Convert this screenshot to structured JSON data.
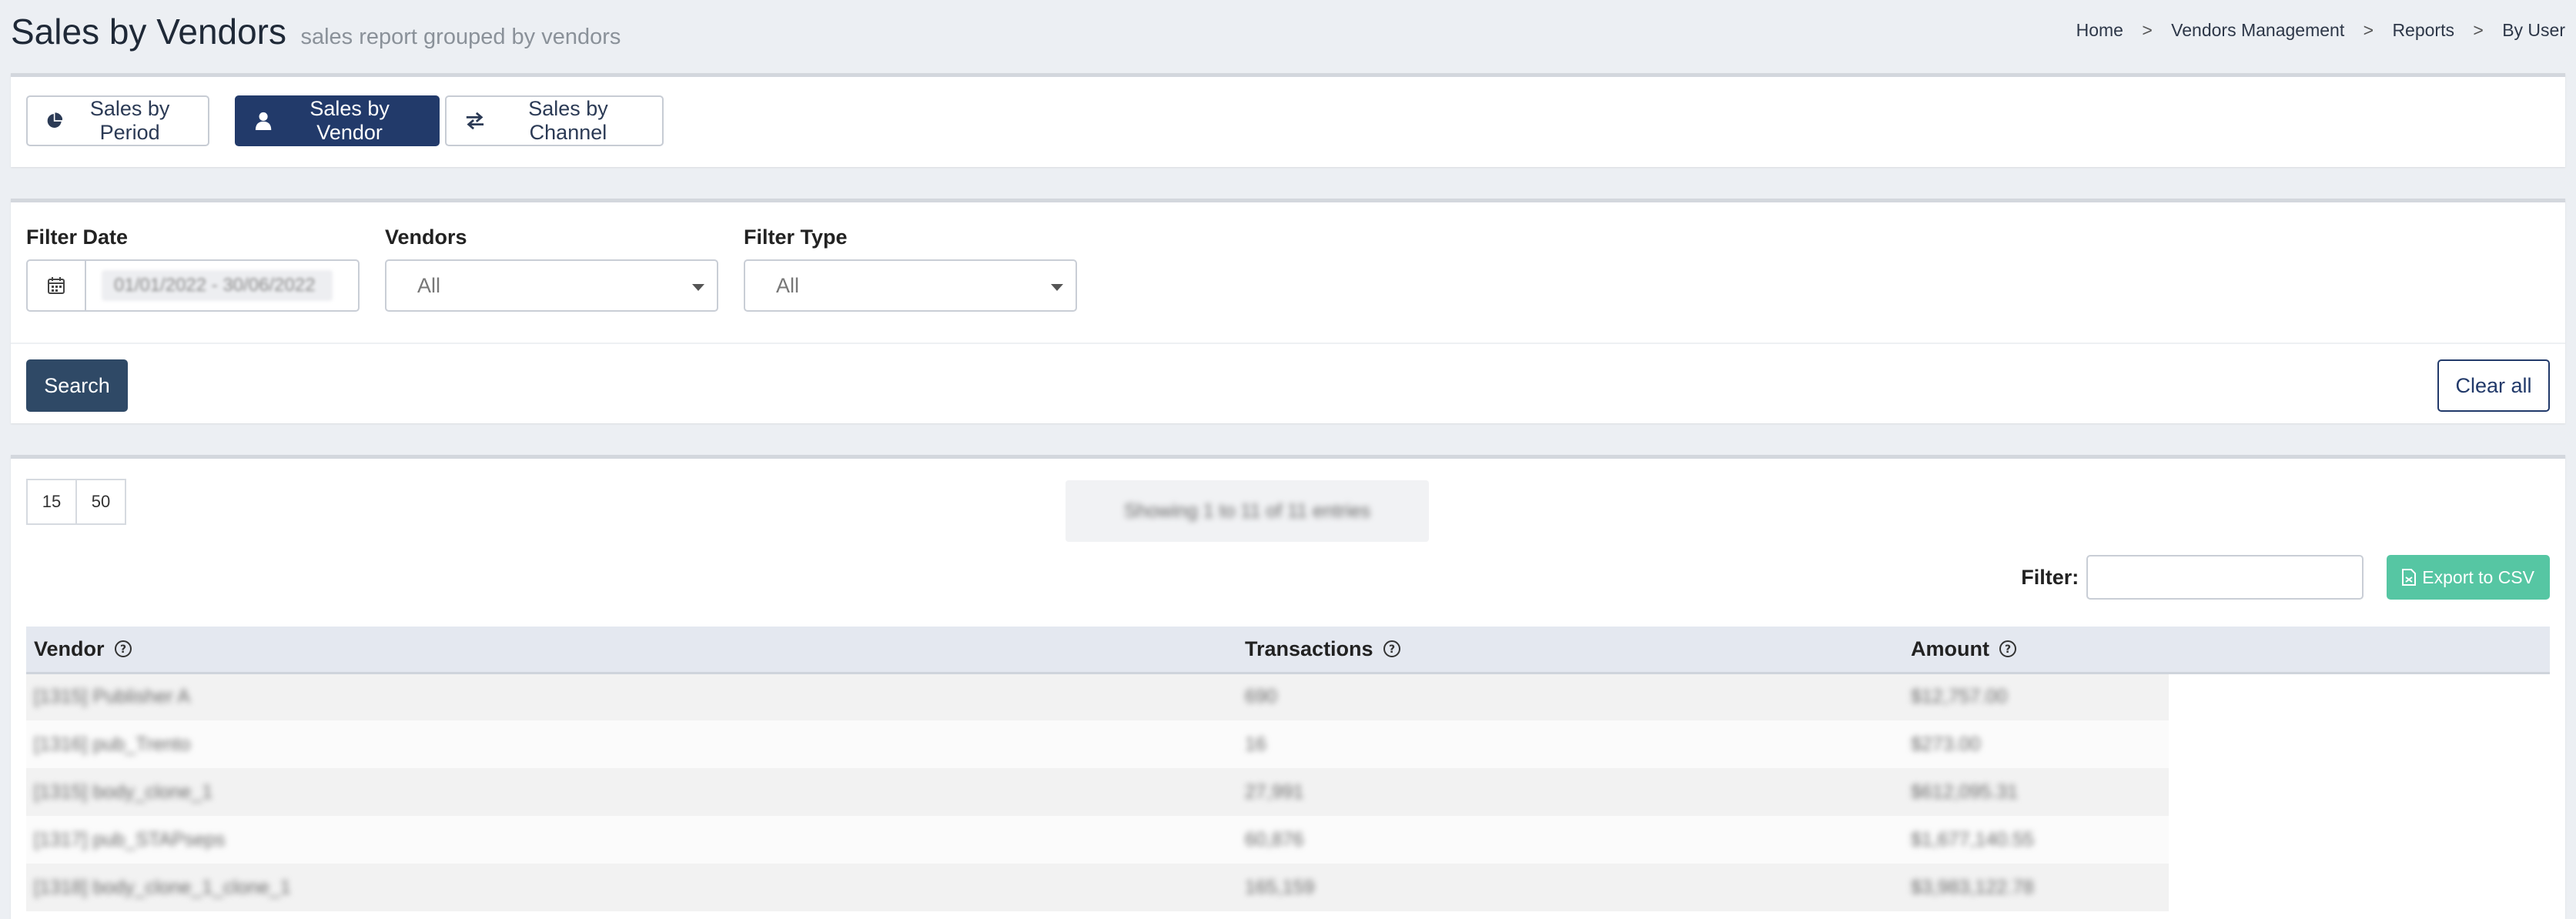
{
  "header": {
    "title": "Sales by Vendors",
    "subtitle": "sales report grouped by vendors",
    "breadcrumb": [
      "Home",
      "Vendors Management",
      "Reports",
      "By User"
    ],
    "breadcrumb_separator": ">"
  },
  "tabs": [
    {
      "label": "Sales by Period",
      "icon": "pie-chart-icon",
      "active": false
    },
    {
      "label": "Sales by Vendor",
      "icon": "user-icon",
      "active": true
    },
    {
      "label": "Sales by Channel",
      "icon": "exchange-icon",
      "active": false
    }
  ],
  "filters": {
    "date_label": "Filter Date",
    "date_value": "01/01/2022 - 30/06/2022",
    "vendors_label": "Vendors",
    "vendors_value": "All",
    "type_label": "Filter Type",
    "type_value": "All",
    "search_label": "Search",
    "clear_label": "Clear all"
  },
  "table_controls": {
    "page_lengths": [
      "15",
      "50"
    ],
    "info": "Showing 1 to 11 of 11 entries",
    "filter_label": "Filter:",
    "filter_value": "",
    "export_label": "Export to CSV"
  },
  "table": {
    "columns": [
      "Vendor",
      "Transactions",
      "Amount"
    ],
    "rows": [
      [
        "[1315] Publisher A",
        "690",
        "$12,757.00"
      ],
      [
        "[1316] pub_Trento",
        "16",
        "$273.00"
      ],
      [
        "[1315] body_clone_1",
        "27,991",
        "$612,095.31"
      ],
      [
        "[1317] pub_STAPseps",
        "60,876",
        "$1,677,140.55"
      ],
      [
        "[1318] body_clone_1_clone_1",
        "165,159",
        "$3,983,122.78"
      ]
    ]
  },
  "colors": {
    "primary": "#223a6a",
    "search_button": "#2f4966",
    "export_button": "#56c6a3",
    "page_background": "#eceff3"
  }
}
